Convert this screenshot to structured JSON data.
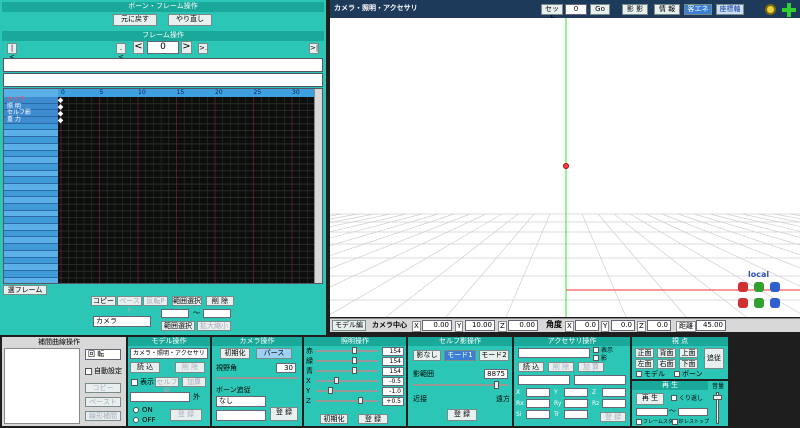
{
  "bone_frame": {
    "title": "ボーン・フレーム操作",
    "undo": "元に戻す",
    "redo": "やり直し"
  },
  "frame_ops": {
    "title": "フレーム操作",
    "first": "|<",
    "prev_key": ".<",
    "prev": "<",
    "frame": "0",
    "next": ">",
    "next_key": ">.",
    "last": ">|"
  },
  "timeline": {
    "ticks": [
      "0",
      "5",
      "10",
      "15",
      "20",
      "25",
      "30"
    ],
    "tracks": [
      "カメラ",
      "照 明",
      "セルフ影",
      "重 力"
    ],
    "extra_rows": 26
  },
  "tl_bottom": {
    "range_btn": "選フレーム",
    "copy": "コピー",
    "paste": "ペースト",
    "paste_rev": "反転P",
    "range_select": "範囲選択",
    "delete": "削 除",
    "camera_sel": "カメラ",
    "range_from": "",
    "range_sep": "～",
    "range_to": "",
    "range_select2": "範囲選択",
    "scale": "拡大縮小"
  },
  "viewport": {
    "title": "カメラ・照明・アクセサリ",
    "set_label": "セット",
    "set_value": "0",
    "go": "Go",
    "shadow": "影 影",
    "info": "情 報",
    "guest": "客エネ",
    "axis": "座標軸",
    "local": "local"
  },
  "cam_bar": {
    "model_edit": "モデル編",
    "camera_center": "カメラ中心",
    "x_label": "X",
    "x_val": "0.00",
    "y_label": "Y",
    "y_val": "10.00",
    "z_label": "Z",
    "z_val": "0.00",
    "angle": "角度",
    "ax_label": "X",
    "ax_val": "0.0",
    "ay_label": "Y",
    "ay_val": "0.0",
    "az_label": "Z",
    "az_val": "0.0",
    "dist_label": "距離",
    "dist_val": "45.00"
  },
  "interp": {
    "title": "補間曲線操作",
    "rotate": "回 転",
    "auto_set": "自動設定",
    "copy": "コピー",
    "paste": "ペースト",
    "linear": "線形補間"
  },
  "model_ops": {
    "title": "モデル操作",
    "selected": "カメラ・照明・アクセサリ",
    "load": "読 込",
    "delete": "削 除",
    "show": "表示",
    "self_shadow": "セルフ影",
    "add": "加算",
    "on": "ON",
    "off": "OFF",
    "register": "登 録",
    "frame_label": "外"
  },
  "camera_ops": {
    "title": "カメラ操作",
    "init": "初期化",
    "perspective": "パース",
    "fov_label": "視野角",
    "fov": "30",
    "bone_follow": "ボーン追従",
    "bone_sel": "なし",
    "register": "登 録"
  },
  "light_ops": {
    "title": "照明操作",
    "r": "154",
    "g": "154",
    "b": "154",
    "x": "-0.5",
    "y": "-1.0",
    "z": "+0.5",
    "init": "初期化",
    "register": "登 録",
    "r_l": "赤",
    "g_l": "緑",
    "b_l": "青",
    "x_l": "X",
    "y_l": "Y",
    "z_l": "Z"
  },
  "self_shadow": {
    "title": "セルフ影操作",
    "none": "影なし",
    "mode1": "モード1",
    "mode2": "モード2",
    "range_label": "影範囲",
    "range": "8875",
    "near": "近接",
    "far": "遠方",
    "register": "登 録"
  },
  "accessory": {
    "title": "アクセサリ操作",
    "show": "表示",
    "shadow": "影",
    "load": "読 込",
    "delete": "削 除",
    "add": "加 算",
    "x": "X",
    "y": "Y",
    "z": "Z",
    "rx": "Rx",
    "ry": "Ry",
    "rz": "Rz",
    "si": "Si",
    "tr": "Tr",
    "register": "登 録"
  },
  "view": {
    "title": "視 点",
    "front": "正面",
    "top": "背面",
    "up": "上面",
    "left": "左面",
    "right": "右面",
    "down": "下面",
    "model": "モデル",
    "bone": "ボーン",
    "follow": "追従"
  },
  "play": {
    "title": "再 生",
    "play": "再 生",
    "loop": "くり返し",
    "vol": "音量",
    "start": "フレームスタート",
    "stop": "フレストップ"
  },
  "colors": {
    "teal": "#2bc6b5",
    "header": "#1aa89a",
    "accent_blue": "#3f8bd0",
    "key": "#ffffff",
    "red_axis": "#ff3030",
    "green_axis": "#30e030"
  }
}
